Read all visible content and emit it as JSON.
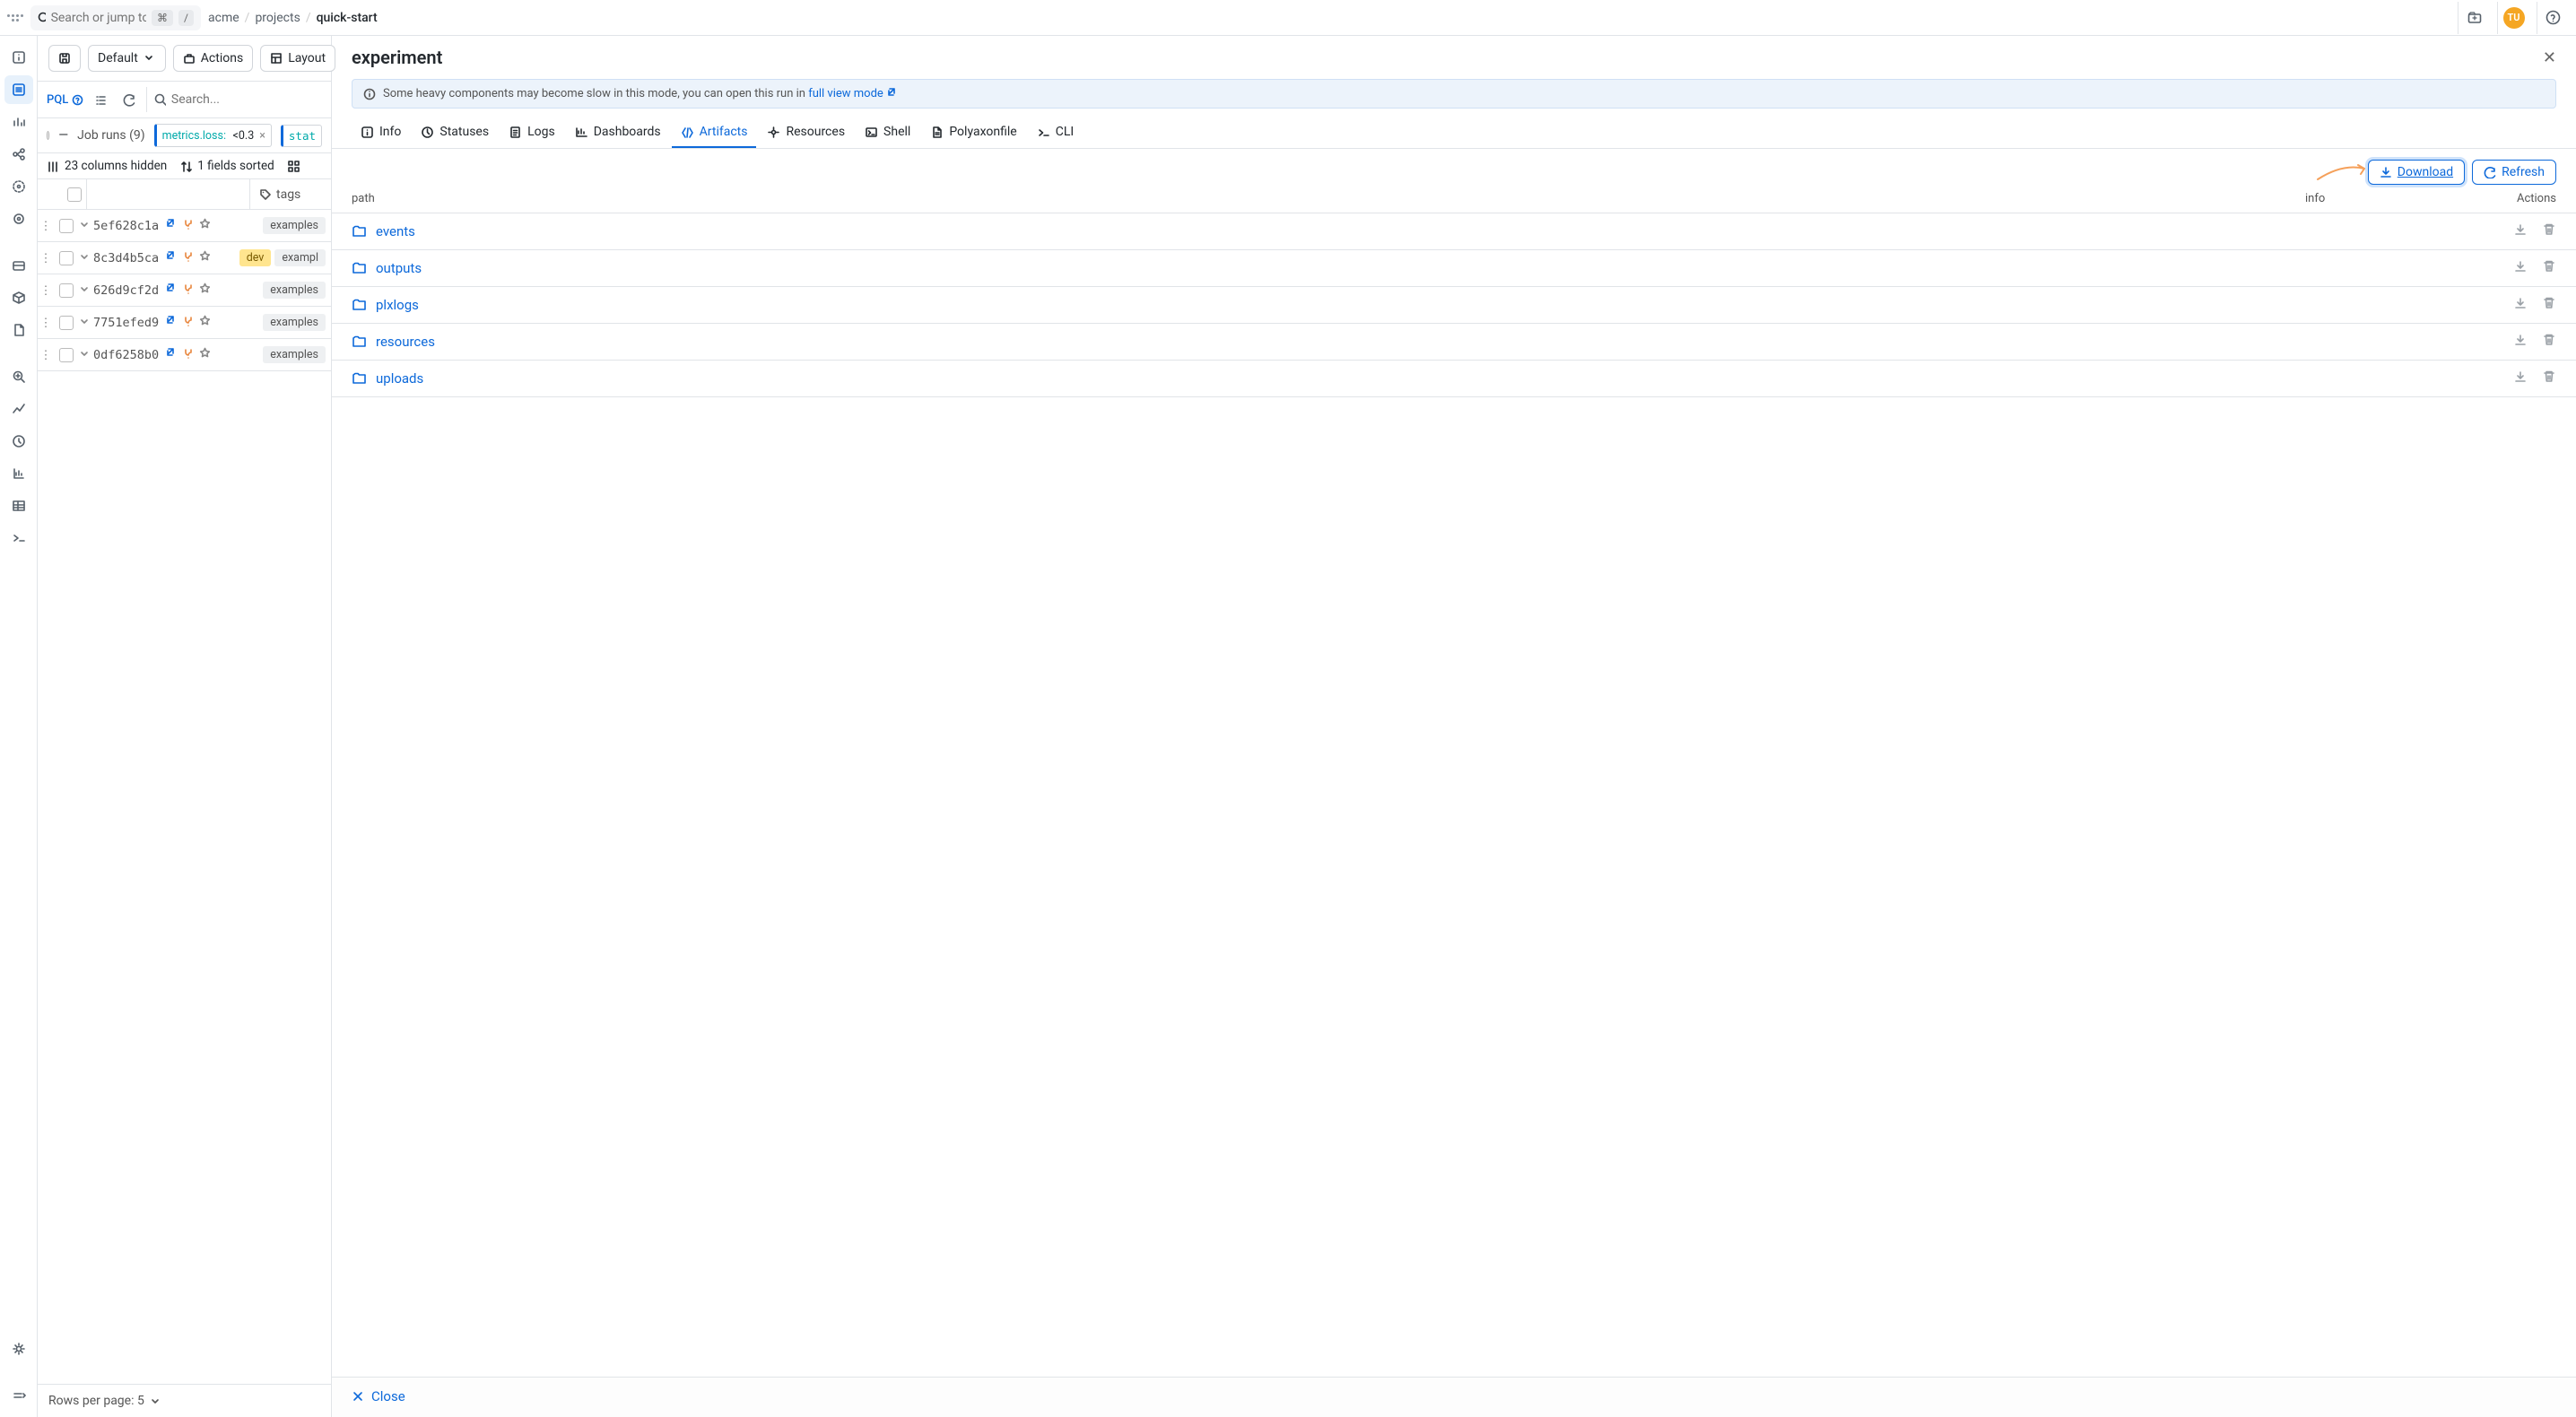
{
  "header": {
    "search_placeholder": "Search or jump to...",
    "kbd": "⌘",
    "slash": "/",
    "breadcrumb": [
      "acme",
      "projects",
      "quick-start"
    ],
    "avatar": "TU"
  },
  "toolbar": {
    "default": "Default",
    "actions": "Actions",
    "layout": "Layout"
  },
  "filter": {
    "pql": "PQL",
    "search_placeholder": "Search...",
    "job_runs_label": "Job runs (9)",
    "pill1_key": "metrics.loss:",
    "pill1_val": "<0.3",
    "pill2": "stat"
  },
  "colsbar": {
    "hidden": "23 columns hidden",
    "sorted": "1 fields sorted"
  },
  "table": {
    "tags_header": "tags",
    "rows": [
      {
        "hash": "5ef628c1a",
        "tags": [
          {
            "t": "examples",
            "k": ""
          }
        ]
      },
      {
        "hash": "8c3d4b5ca",
        "tags": [
          {
            "t": "dev",
            "k": "dev"
          },
          {
            "t": "exampl",
            "k": ""
          }
        ]
      },
      {
        "hash": "626d9cf2d",
        "tags": [
          {
            "t": "examples",
            "k": ""
          }
        ]
      },
      {
        "hash": "7751efed9",
        "tags": [
          {
            "t": "examples",
            "k": ""
          }
        ]
      },
      {
        "hash": "0df6258b0",
        "tags": [
          {
            "t": "examples",
            "k": ""
          }
        ]
      }
    ]
  },
  "footer": {
    "rows_per_page": "Rows per page: 5"
  },
  "detail": {
    "title": "experiment",
    "banner_text": "Some heavy components may become slow in this mode, you can open this run in ",
    "banner_link": "full view mode",
    "tabs": [
      "Info",
      "Statuses",
      "Logs",
      "Dashboards",
      "Artifacts",
      "Resources",
      "Shell",
      "Polyaxonfile",
      "CLI"
    ],
    "active_tab": 4,
    "download": "Download",
    "refresh": "Refresh",
    "cols": {
      "path": "path",
      "info": "info",
      "actions": "Actions"
    },
    "files": [
      "events",
      "outputs",
      "plxlogs",
      "resources",
      "uploads"
    ],
    "close": "Close"
  }
}
